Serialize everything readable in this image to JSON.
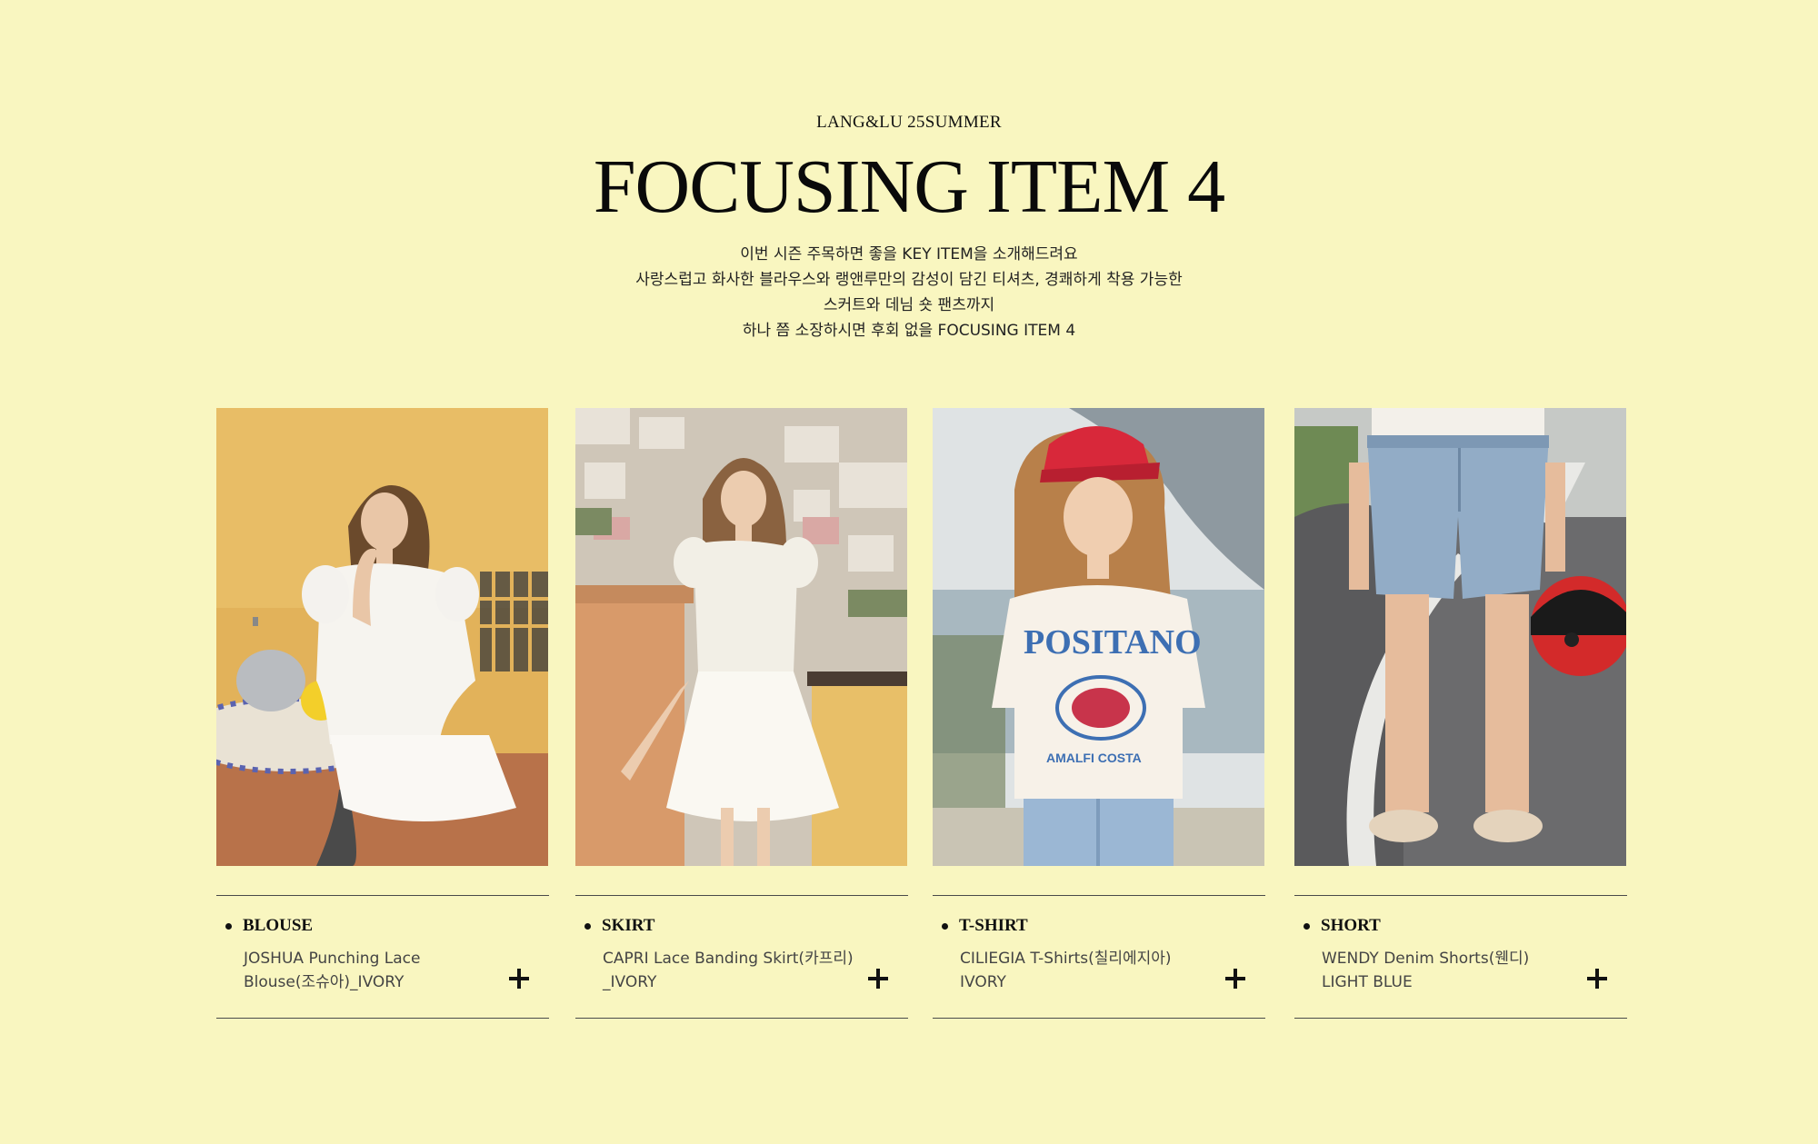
{
  "header": {
    "eyebrow": "LANG&LU 25SUMMER",
    "title": "FOCUSING ITEM 4",
    "intro_lines": [
      "이번 시즌 주목하면 좋을 KEY ITEM을 소개해드려요",
      "사랑스럽고 화사한 블라우스와 랭앤루만의 감성이 담긴 티셔츠, 경쾌하게 착용 가능한",
      "스커트와 데님 숏 팬츠까지",
      "하나 쯤 소장하시면 후회 없을 FOCUSING ITEM 4"
    ]
  },
  "items": [
    {
      "category": "BLOUSE",
      "name": "JOSHUA Punching Lace\nBlouse(조슈아)_IVORY",
      "photo": "woman in white lace blouse at mosaic cafe table"
    },
    {
      "category": "SKIRT",
      "name": "CAPRI Lace Banding Skirt(카프리)\n_IVORY",
      "photo": "woman in white lace top and tiered skirt on coastal balcony"
    },
    {
      "category": "T-SHIRT",
      "name": "CILIEGIA T-Shirts(칠리에지아)\nIVORY",
      "photo": "woman in red cap and printed ivory t-shirt by the sea"
    },
    {
      "category": "SHORT",
      "name": "WENDY Denim Shorts(웬디)\nLIGHT BLUE",
      "photo": "denim shorts with red helmet on road"
    }
  ],
  "colors": {
    "background": "#f9f6c0",
    "text": "#111111"
  }
}
